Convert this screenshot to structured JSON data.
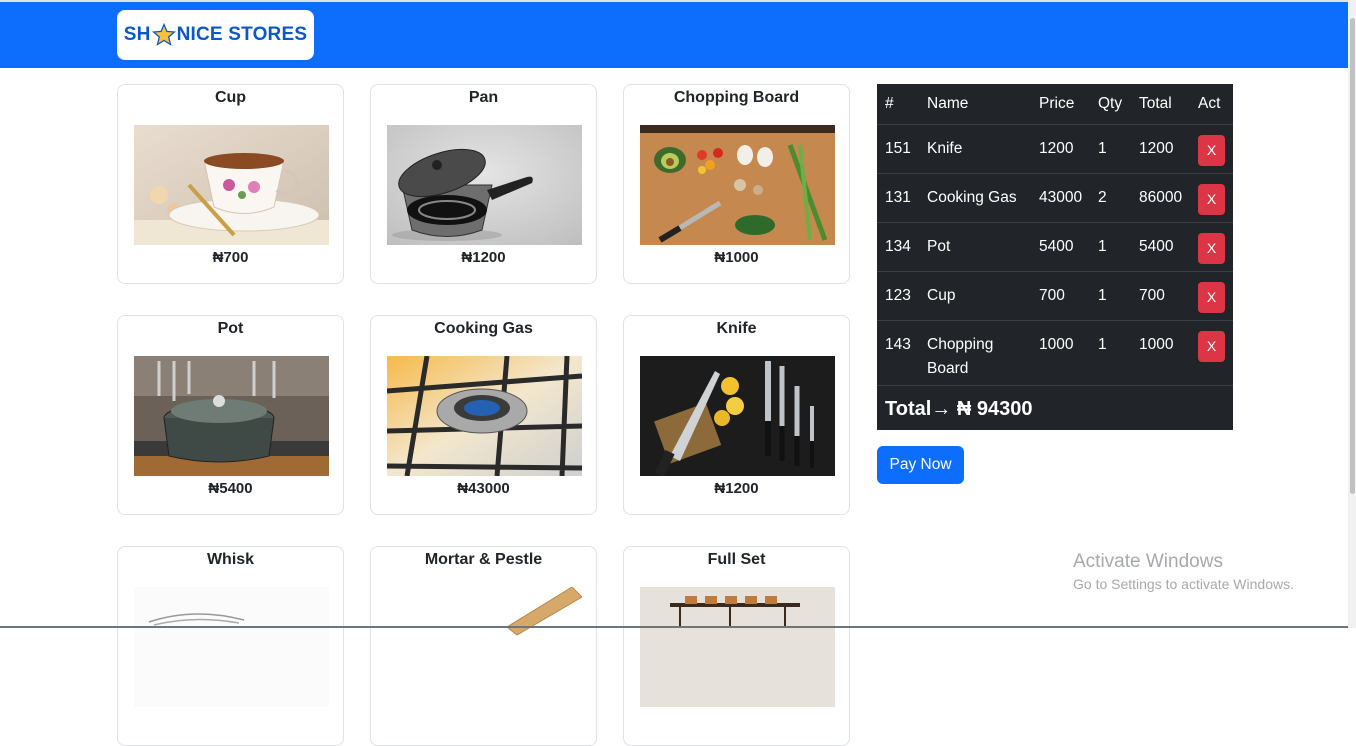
{
  "brand": {
    "text_pre": "SH",
    "text_post": "NICE STORES"
  },
  "products": [
    {
      "name": "Cup",
      "price": "₦700",
      "image": "teacup-photo"
    },
    {
      "name": "Pan",
      "price": "₦1200",
      "image": "saucepan-photo"
    },
    {
      "name": "Chopping Board",
      "price": "₦1000",
      "image": "chopping-board-photo"
    },
    {
      "name": "Pot",
      "price": "₦5400",
      "image": "pot-photo"
    },
    {
      "name": "Cooking Gas",
      "price": "₦43000",
      "image": "gas-burner-photo"
    },
    {
      "name": "Knife",
      "price": "₦1200",
      "image": "knives-photo"
    },
    {
      "name": "Whisk",
      "price": "",
      "image": "whisk-photo"
    },
    {
      "name": "Mortar & Pestle",
      "price": "",
      "image": "pestle-photo"
    },
    {
      "name": "Full Set",
      "price": "",
      "image": "pan-rack-photo"
    }
  ],
  "cart": {
    "headers": [
      "#",
      "Name",
      "Price",
      "Qty",
      "Total",
      "Act"
    ],
    "rows": [
      {
        "id": "151",
        "name": "Knife",
        "price": "1200",
        "qty": "1",
        "total": "1200",
        "action": "X"
      },
      {
        "id": "131",
        "name": "Cooking Gas",
        "price": "43000",
        "qty": "2",
        "total": "86000",
        "action": "X"
      },
      {
        "id": "134",
        "name": "Pot",
        "price": "5400",
        "qty": "1",
        "total": "5400",
        "action": "X"
      },
      {
        "id": "123",
        "name": "Cup",
        "price": "700",
        "qty": "1",
        "total": "700",
        "action": "X"
      },
      {
        "id": "143",
        "name": "Chopping Board",
        "price": "1000",
        "qty": "1",
        "total": "1000",
        "action": "X"
      }
    ],
    "total_text": "Total→ ₦ 94300"
  },
  "pay_button": "Pay Now",
  "watermark": {
    "line1": "Activate Windows",
    "line2": "Go to Settings to activate Windows."
  },
  "colors": {
    "primary": "#0d6efd",
    "danger": "#dc3545",
    "dark": "#212529"
  }
}
